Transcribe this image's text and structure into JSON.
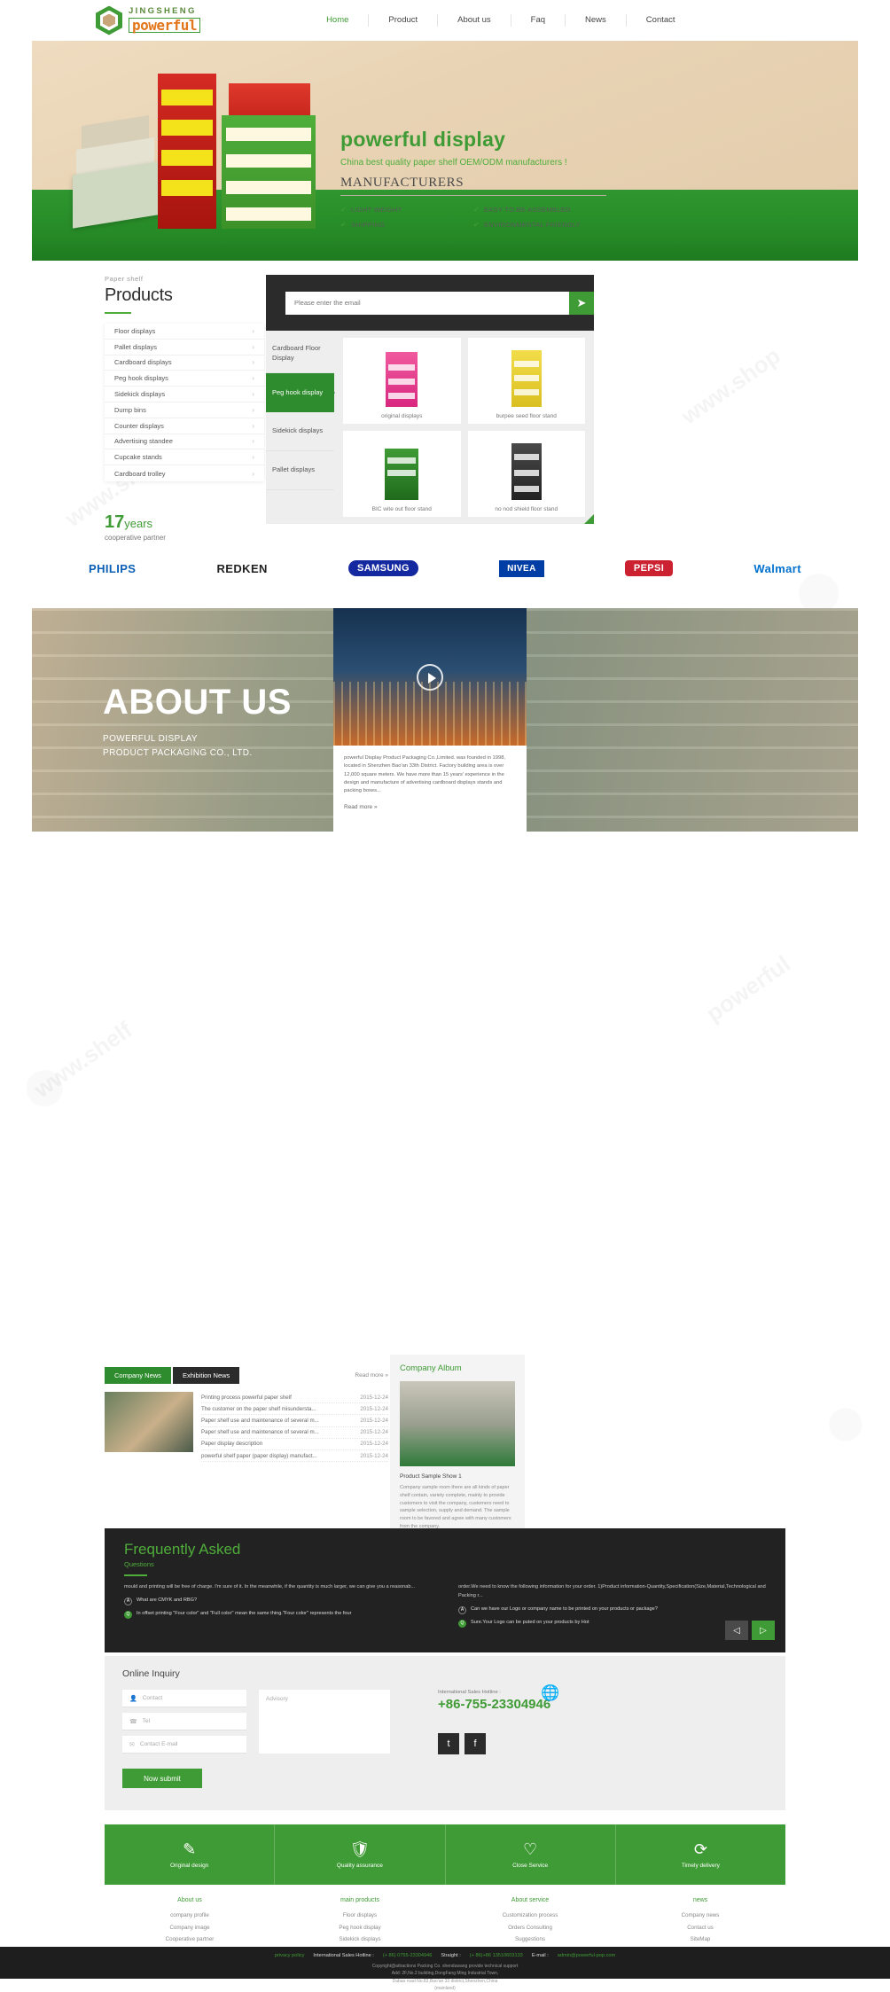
{
  "header": {
    "logo_line1": "JINGSHENG",
    "logo_line2": "powerful",
    "nav": [
      {
        "label": "Home"
      },
      {
        "label": "Product"
      },
      {
        "label": "About us"
      },
      {
        "label": "Faq"
      },
      {
        "label": "News"
      },
      {
        "label": "Contact"
      }
    ]
  },
  "hero": {
    "headline": "powerful display",
    "subheadline": "China best quality paper shelf OEM/ODM manufacturers !",
    "manufacturers": "MANUFACTURERS",
    "features": [
      "LIGHT WEIGHT",
      "EASY TO BE ASSEMBLED",
      "SHIPPING",
      "ENVIRONMENTAL FRIENDLY"
    ],
    "check_glyph": "✔"
  },
  "products": {
    "kicker": "Paper shelf",
    "title": "Products",
    "menu": [
      "Floor displays",
      "Pallet displays",
      "Cardboard displays",
      "Peg hook displays",
      "Sidekick displays",
      "Dump bins",
      "Counter displays",
      "Advertising standee",
      "Cupcake stands",
      "Cardboard trolley"
    ],
    "chevron": "›",
    "email_placeholder": "Please enter the email",
    "send_icon": "➤",
    "tabs": [
      {
        "label": "Cardboard Floor Display",
        "active": false
      },
      {
        "label": "Peg hook display",
        "active": true
      },
      {
        "label": "Sidekick displays",
        "active": false
      },
      {
        "label": "Pallet displays",
        "active": false
      }
    ],
    "items": [
      {
        "caption": "original displays"
      },
      {
        "caption": "burpee seed floor stand"
      },
      {
        "caption": "BIC wite out floor stand"
      },
      {
        "caption": "no nod shield floor stand"
      }
    ]
  },
  "years": {
    "number": "17",
    "unit": "years",
    "subtitle": "cooperative partner"
  },
  "brands": [
    {
      "name": "PHILIPS",
      "color": "#0b5fb5"
    },
    {
      "name": "REDKEN",
      "color": "#222222"
    },
    {
      "name": "SAMSUNG",
      "color": "#1428a0"
    },
    {
      "name": "NIVEA",
      "color": "#003da5"
    },
    {
      "name": "PEPSI",
      "color": "#cc2131"
    },
    {
      "name": "Walmart",
      "color": "#0071ce"
    }
  ],
  "about": {
    "title": "ABOUT US",
    "line1": "POWERFUL DISPLAY",
    "line2": "PRODUCT PACKAGING CO., LTD.",
    "paragraph": "powerful Display Product Packaging Co.,Limited. was founded in 1998, located in Shenzhen Bao'an 33th District. Factory building area is over 12,000 square meters. We have more than 15 years' experience in the design and manufacture of advertising cardboard displays stands and packing boxes...",
    "read_more": "Read more »"
  },
  "news": {
    "tab_active": "Company News",
    "tab_inactive": "Exhibition News",
    "read_more": "Read more »",
    "items": [
      {
        "title": "Printing process powerful paper shelf",
        "date": "2015-12-24"
      },
      {
        "title": "The customer on the paper shelf misundersta...",
        "date": "2015-12-24"
      },
      {
        "title": "Paper shelf use and maintenance of several m...",
        "date": "2015-12-24"
      },
      {
        "title": "Paper shelf use and maintenance of several m...",
        "date": "2015-12-24"
      },
      {
        "title": "Paper display description",
        "date": "2015-12-24"
      },
      {
        "title": "powerful shelf paper (paper display) manufact...",
        "date": "2015-12-24"
      }
    ]
  },
  "album": {
    "title": "Company Album",
    "caption": "Product Sample Show 1",
    "description": "Company sample room there are all kinds of paper shelf contain, variety complete, mainly to provide customers to visit the company, customers need to sample selection, supply and demand. The sample room to be favored and agree with many customers from the company."
  },
  "faq": {
    "title": "Frequently Asked",
    "subtitle": "Questions",
    "left": {
      "answer": "mould and printing will be free of charge. I'm sure of it.      In the meanwhile, if the quantity is much larger, we can give you a reasonab...",
      "q1_badge": "A",
      "q1": "What are CMYK and RBG?",
      "q2_badge": "Q",
      "q2": "In offset printing \"Four color\" and \"Full color\" mean the same thing.\"Four color\" represents the four"
    },
    "right": {
      "answer": "order.We need to know the following information for your order.       1)Product information-Quantity,Specification(Size,Material,Technological and Packing r...",
      "q1_badge": "A",
      "q1": "Can we have our Logo or company name to be printed on your products or package?",
      "q2_badge": "Q",
      "q2": "Sure.Your Logo can be puted on your products by Hot"
    },
    "prev": "◁",
    "next": "▷"
  },
  "inquiry": {
    "title": "Online Inquiry",
    "fields": [
      {
        "icon": "👤",
        "placeholder": "Contact"
      },
      {
        "icon": "☎",
        "placeholder": "Tel"
      },
      {
        "icon": "✉",
        "placeholder": "Contact E-mail"
      }
    ],
    "textarea_placeholder": "Advisory",
    "submit": "Now submit",
    "hotline_label": "International Sales Hotline :",
    "hotline_number": "+86-755-23304946",
    "social": [
      {
        "icon": "t"
      },
      {
        "icon": "f"
      }
    ]
  },
  "services": [
    {
      "icon": "✎",
      "label": "Original design"
    },
    {
      "icon": "🛡",
      "label": "Quality assurance"
    },
    {
      "icon": "♡",
      "label": "Close Service"
    },
    {
      "icon": "⟳",
      "label": "Timely delivery"
    }
  ],
  "footer_links": [
    {
      "heading": "About us",
      "links": [
        "company profile",
        "Company image",
        "Cooperative partner"
      ]
    },
    {
      "heading": "main products",
      "links": [
        "Floor displays",
        "Peg hook display",
        "Sidekick displays"
      ]
    },
    {
      "heading": "About service",
      "links": [
        "Customization process",
        "Orders Consulting",
        "Suggestions"
      ]
    },
    {
      "heading": "news",
      "links": [
        "Company news",
        "Contact us",
        "SiteMap"
      ]
    }
  ],
  "footer_bar": {
    "privacy": "privacy policy",
    "hotline_label": "International Sales Hotline :",
    "hotline_value": "(+ 86) 0755-23304946",
    "straight_label": "Straight :",
    "straight_value": "(+ 86)+86 13510603133",
    "email_label": "E-mail :",
    "email_value": "admin@powerful-pop.com",
    "copyright": "Copyright@attractions Packing Co. shenduwang provide technical support",
    "address1": "Add: 2F,No.2 building,DongFang Ming Industrial Town,",
    "address2": "Dabao road No.83,Bao'an 33 district,Shenzhen,China",
    "address3": "(mainland)"
  }
}
